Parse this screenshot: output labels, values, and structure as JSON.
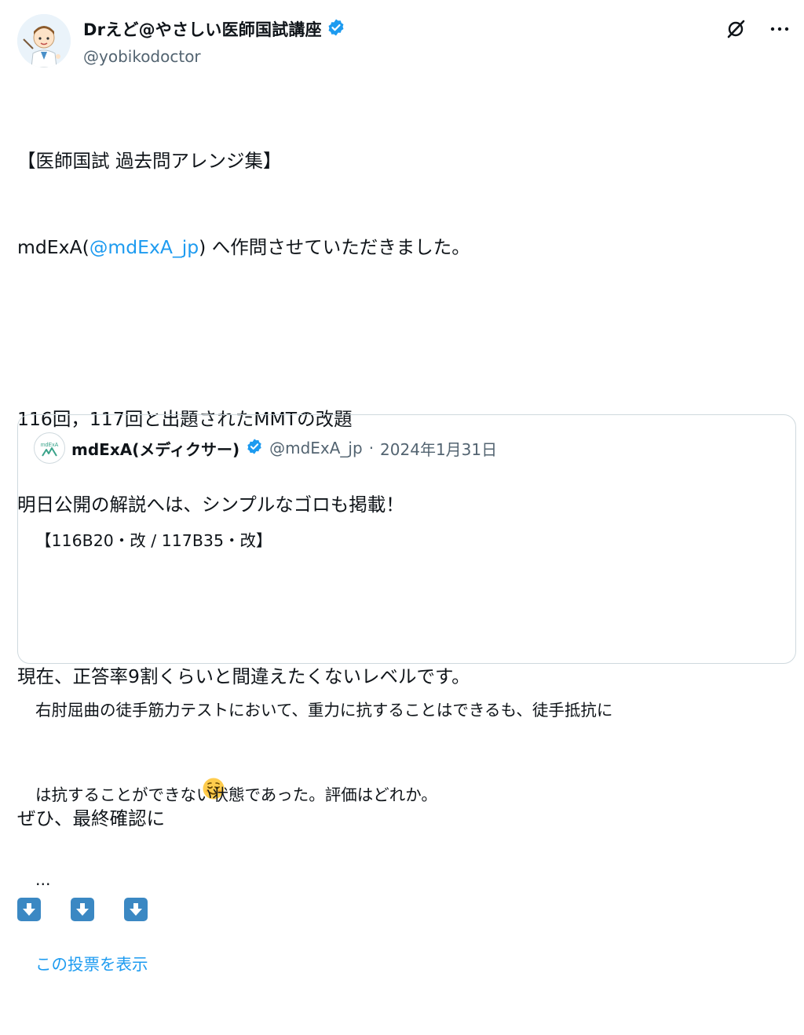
{
  "author": {
    "display_name": "Drえど@やさしい医師国試講座",
    "handle": "@yobikodoctor",
    "verified": true,
    "avatar_icon": "doctor-illustration-avatar"
  },
  "actions": {
    "grok_icon": "grok-icon",
    "more_icon": "more-icon",
    "more_label": "···"
  },
  "tweet": {
    "line1": "【医師国試 過去問アレンジ集】",
    "line2_prefix": "mdExA(",
    "line2_mention": "@mdExA_jp",
    "line2_suffix": ") へ作問させていただきました。",
    "line3": "116回，117回と出題されたMMTの改題",
    "line4": "明日公開の解説へは、シンプルなゴロも掲載！",
    "line5": "現在、正答率9割くらいと間違えたくないレベルです。",
    "line6": "ぜひ、最終確認に",
    "emoji_face": "relieved-face",
    "emoji_arrows": [
      "down-arrow",
      "down-arrow",
      "down-arrow"
    ]
  },
  "quote": {
    "display_name": "mdExA(メディクサー)",
    "avatar_label": "mdExA",
    "verified": true,
    "handle": "@mdExA_jp",
    "separator": "·",
    "date": "2024年1月31日",
    "line1": "【116B20・改 / 117B35・改】",
    "line2": "右肘屈曲の徒手筋力テストにおいて、重力に抗することはできるも、徒手抵抗に",
    "line3": "は抗することができない状態であった。評価はどれか。",
    "ellipsis": "...",
    "show_poll": "この投票を表示"
  },
  "colors": {
    "link": "#1d9bf0",
    "verified": "#1d9bf0",
    "secondary_text": "#536471",
    "border": "#cfd9de"
  }
}
